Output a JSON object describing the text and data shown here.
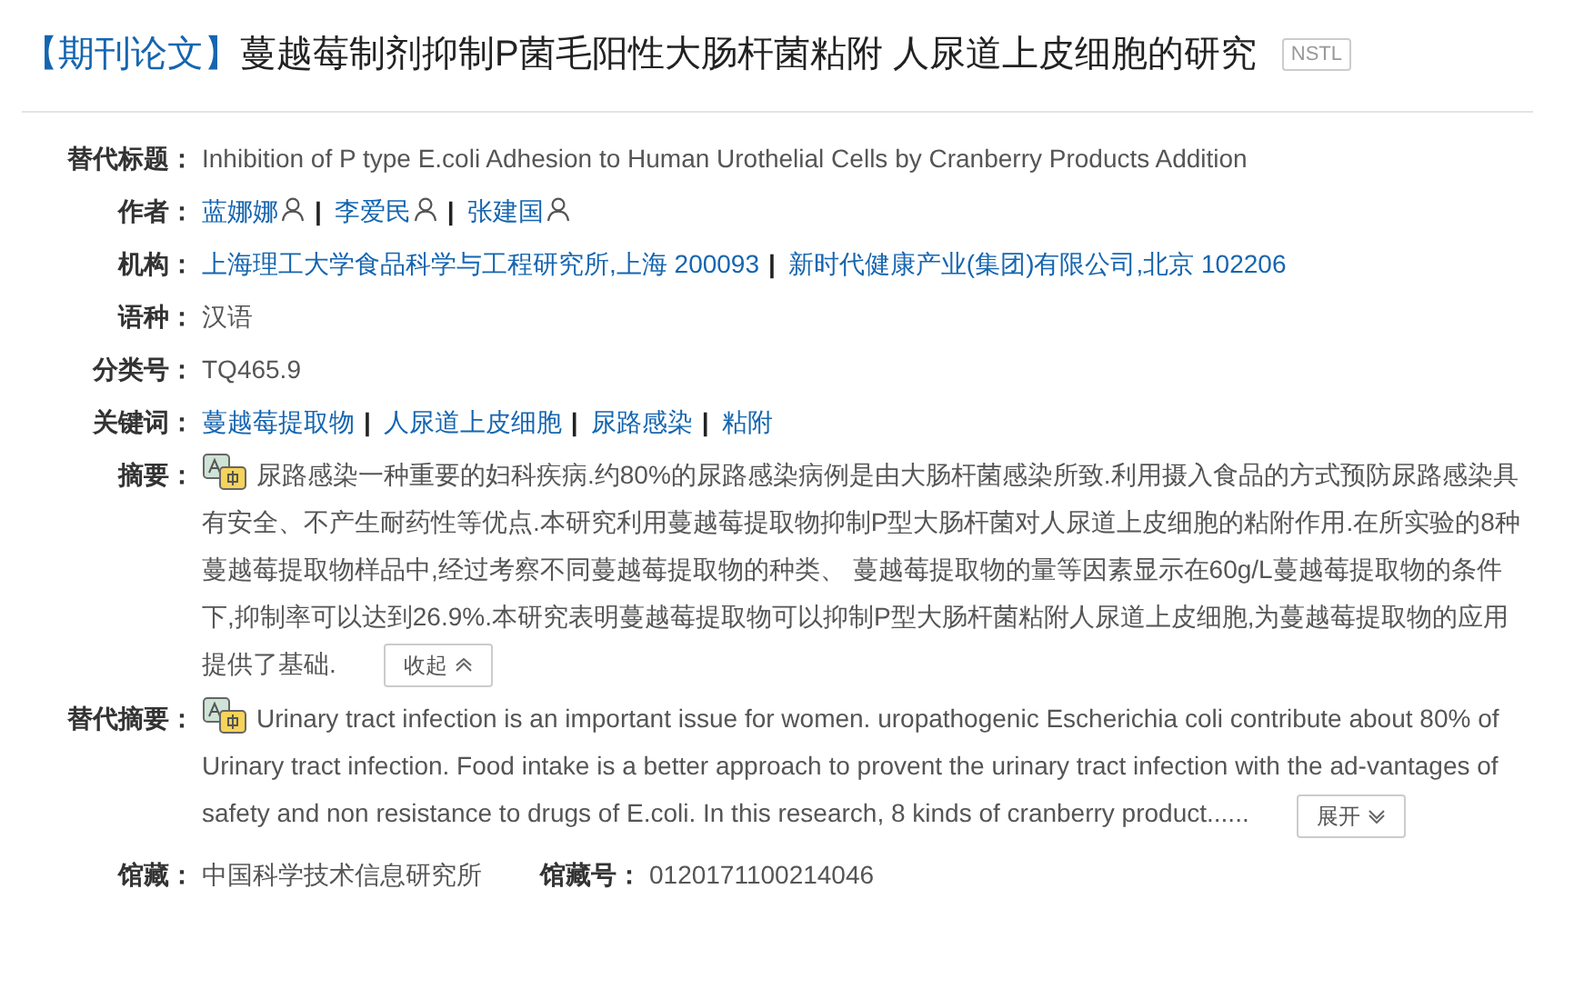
{
  "title": {
    "tag": "【期刊论文】",
    "text": "蔓越莓制剂抑制P菌毛阳性大肠杆菌粘附 人尿道上皮细胞的研究",
    "badge": "NSTL"
  },
  "fields": [
    {
      "kind": "text",
      "label": "替代标题：",
      "value": "Inhibition of P type E.coli Adhesion to Human Urothelial Cells by Cranberry Products Addition"
    },
    {
      "kind": "people",
      "label": "作者：",
      "separator": "|",
      "items": [
        "蓝娜娜",
        "李爱民",
        "张建国"
      ]
    },
    {
      "kind": "links",
      "label": "机构：",
      "separator": "|",
      "items": [
        "上海理工大学食品科学与工程研究所,上海 200093",
        "新时代健康产业(集团)有限公司,北京 102206"
      ]
    },
    {
      "kind": "text",
      "label": "语种：",
      "value": "汉语"
    },
    {
      "kind": "text",
      "label": "分类号：",
      "value": "TQ465.9"
    },
    {
      "kind": "links",
      "label": "关键词：",
      "separator": "|",
      "items": [
        "蔓越莓提取物",
        "人尿道上皮细胞",
        "尿路感染",
        "粘附"
      ]
    },
    {
      "kind": "abstract",
      "label": "摘要：",
      "value": "尿路感染一种重要的妇科疾病.约80%的尿路感染病例是由大肠杆菌感染所致.利用摄入食品的方式预防尿路感染具有安全、不产生耐药性等优点.本研究利用蔓越莓提取物抑制P型大肠杆菌对人尿道上皮细胞的粘附作用.在所实验的8种蔓越莓提取物样品中,经过考察不同蔓越莓提取物的种类、 蔓越莓提取物的量等因素显示在60g/L蔓越莓提取物的条件下,抑制率可以达到26.9%.本研究表明蔓越莓提取物可以抑制P型大肠杆菌粘附人尿道上皮细胞,为蔓越莓提取物的应用提供了基础.",
      "expanded": true,
      "button": "收起"
    },
    {
      "kind": "abstract",
      "label": "替代摘要：",
      "value": "Urinary tract infection is an important issue for women. uropathogenic Escherichia coli contribute about 80% of Urinary tract infection. Food intake is a better approach to provent the urinary tract infection with the ad-vantages of safety and non resistance to drugs of E.coli. In this research, 8 kinds of cranberry product......",
      "expanded": false,
      "button": "展开"
    }
  ],
  "holdings": [
    {
      "label": "馆藏：",
      "value": "中国科学技术信息研究所"
    },
    {
      "label": "馆藏号：",
      "value": "0120171100214046"
    }
  ]
}
